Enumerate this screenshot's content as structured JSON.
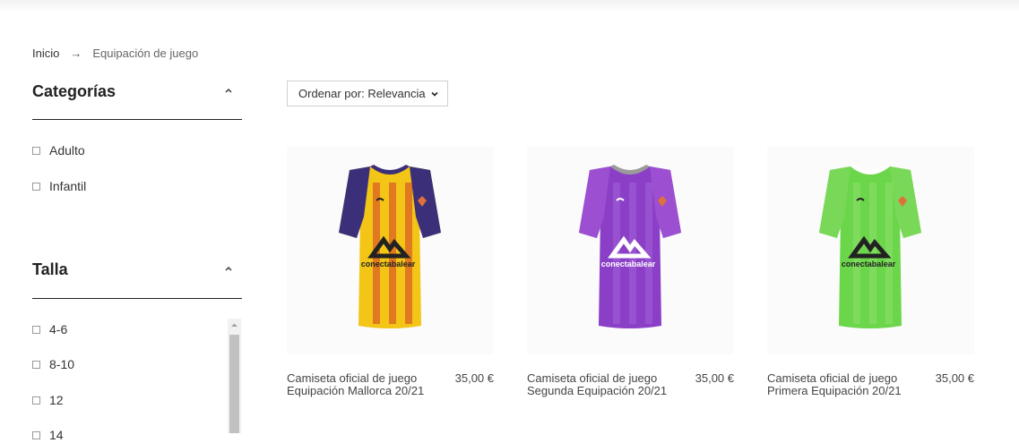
{
  "breadcrumb": {
    "home": "Inicio",
    "separator": "→",
    "current": "Equipación de juego"
  },
  "sidebar": {
    "categories": {
      "title": "Categorías",
      "items": [
        {
          "label": "Adulto"
        },
        {
          "label": "Infantil"
        }
      ]
    },
    "size": {
      "title": "Talla",
      "items": [
        {
          "label": "4-6"
        },
        {
          "label": "8-10"
        },
        {
          "label": "12"
        },
        {
          "label": "14"
        }
      ]
    }
  },
  "sort": {
    "label": "Ordenar por: Relevancia"
  },
  "products": [
    {
      "title_line1": "Camiseta oficial de juego",
      "title_line2": "Equipación Mallorca 20/21",
      "price": "35,00 €",
      "sponsor": "conectabalear",
      "colors": {
        "body": "#f2c516",
        "stripe": "#d43a2a",
        "sleeve": "#3c2f7a",
        "collar": "#3c2f7a",
        "logo": "#222222"
      }
    },
    {
      "title_line1": "Camiseta oficial de juego",
      "title_line2": "Segunda Equipación 20/21",
      "price": "35,00 €",
      "sponsor": "conectabalear",
      "colors": {
        "body": "#8a3fc6",
        "stripe": "#a460d8",
        "sleeve": "#9c4fd0",
        "collar": "#9a9a9a",
        "logo": "#ffffff"
      }
    },
    {
      "title_line1": "Camiseta oficial de juego",
      "title_line2": "Primera Equipación 20/21",
      "price": "35,00 €",
      "sponsor": "conectabalear",
      "colors": {
        "body": "#6cd64a",
        "stripe": "#8fe06e",
        "sleeve": "#7ad858",
        "collar": "#ffffff",
        "logo": "#222222"
      }
    }
  ]
}
